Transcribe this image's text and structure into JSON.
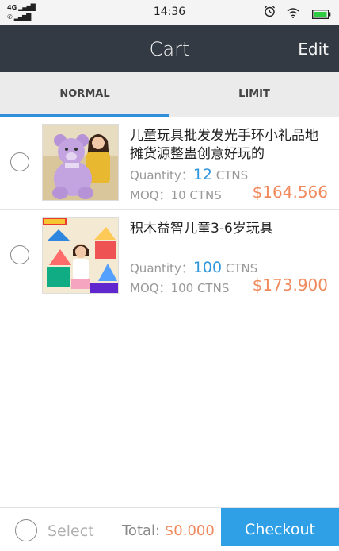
{
  "status_bar": {
    "network": "4G",
    "signal_icon": "signal-bars-icon",
    "call_icon": "phone-icon",
    "time": "14:36",
    "alarm_icon": "alarm-clock-icon",
    "wifi_icon": "wifi-icon",
    "battery_icon": "battery-icon",
    "battery_color": "#2ecc40"
  },
  "nav": {
    "title": "Cart",
    "edit_label": "Edit",
    "background": "#343a44"
  },
  "tabs": [
    {
      "label": "NORMAL",
      "active": true
    },
    {
      "label": "LIMIT",
      "active": false
    }
  ],
  "accent_color": "#2f8fd8",
  "items": [
    {
      "title": "儿童玩具批发发光手环小礼品地摊货源整蛊创意好玩的",
      "image": "purple-teddy-bear-photo",
      "quantity_label": "Quantity：",
      "quantity_value": "12",
      "quantity_unit": " CTNS",
      "moq_label": "MOQ：",
      "moq_value": "10 CTNS",
      "price": "$164.566"
    },
    {
      "title": "积木益智儿童3-6岁玩具",
      "image": "magnetic-blocks-photo",
      "quantity_label": "Quantity：",
      "quantity_value": "100",
      "quantity_unit": " CTNS",
      "moq_label": "MOQ：",
      "moq_value": "100 CTNS",
      "price": "$173.900"
    }
  ],
  "footer": {
    "select_label": "Select",
    "total_label": "Total: ",
    "total_value": "$0.000",
    "checkout_label": "Checkout",
    "price_color": "#f08a5c",
    "checkout_color": "#2fa0e6"
  }
}
